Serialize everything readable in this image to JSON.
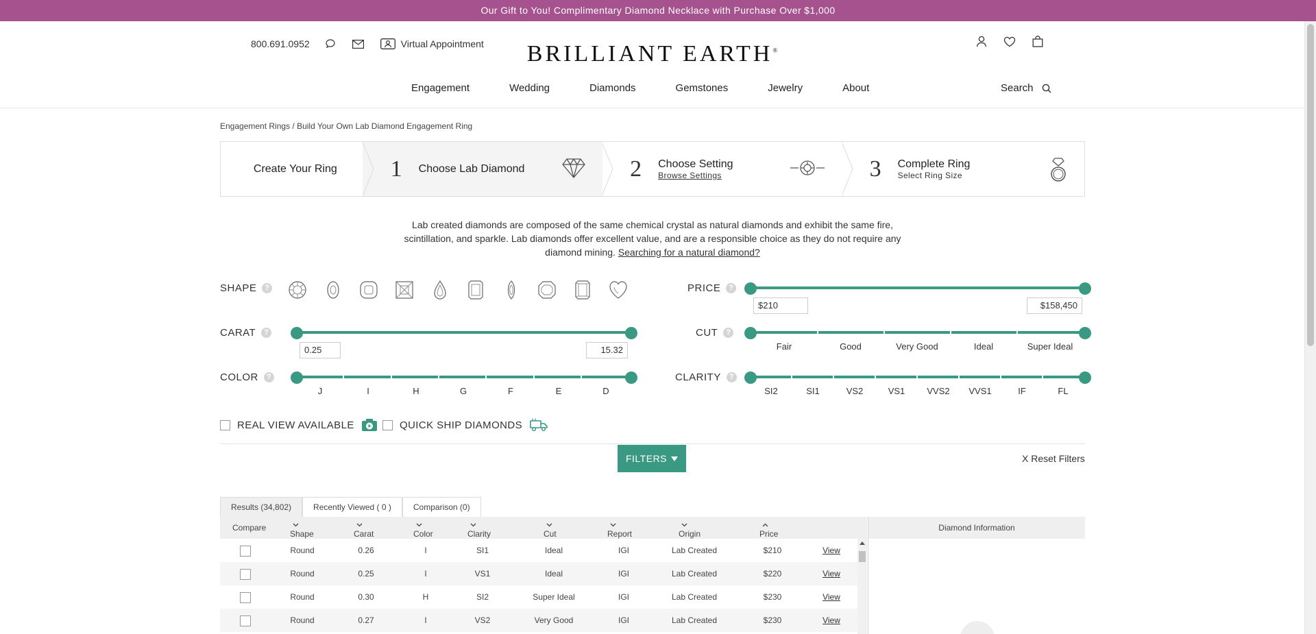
{
  "promo": {
    "text": "Our Gift to You! Complimentary Diamond Necklace with Purchase Over $1,000"
  },
  "header": {
    "phone": "800.691.0952",
    "virtual_appointment": "Virtual Appointment",
    "logo": "BRILLIANT EARTH",
    "logo_mark": "®",
    "nav": [
      "Engagement",
      "Wedding",
      "Diamonds",
      "Gemstones",
      "Jewelry",
      "About"
    ],
    "search_label": "Search"
  },
  "breadcrumb": "Engagement Rings / Build Your Own Lab Diamond Engagement Ring",
  "steps": {
    "create": "Create Your Ring",
    "step1": {
      "num": "1",
      "label": "Choose Lab Diamond"
    },
    "step2": {
      "num": "2",
      "label": "Choose Setting",
      "sub": "Browse Settings"
    },
    "step3": {
      "num": "3",
      "label": "Complete Ring",
      "sub": "Select Ring Size"
    }
  },
  "intro": {
    "text": "Lab created diamonds are composed of the same chemical crystal as natural diamonds and exhibit the same fire, scintillation, and sparkle. Lab diamonds offer excellent value, and are a responsible choice as they do not require any diamond mining.",
    "link": "Searching for a natural diamond?"
  },
  "filters": {
    "shape_label": "SHAPE",
    "shapes": [
      "round",
      "oval",
      "cushion",
      "princess",
      "pear",
      "emerald",
      "marquise",
      "asscher",
      "radiant",
      "heart"
    ],
    "price_label": "PRICE",
    "price_min": "$210",
    "price_max": "$158,450",
    "carat_label": "CARAT",
    "carat_min": "0.25",
    "carat_max": "15.32",
    "cut_label": "CUT",
    "cut_grades": [
      "Fair",
      "Good",
      "Very Good",
      "Ideal",
      "Super Ideal"
    ],
    "color_label": "COLOR",
    "color_grades": [
      "J",
      "I",
      "H",
      "G",
      "F",
      "E",
      "D"
    ],
    "clarity_label": "CLARITY",
    "clarity_grades": [
      "SI2",
      "SI1",
      "VS2",
      "VS1",
      "VVS2",
      "VVS1",
      "IF",
      "FL"
    ],
    "help_glyph": "?",
    "real_view": "REAL VIEW AVAILABLE",
    "quick_ship": "QUICK SHIP DIAMONDS",
    "filters_button": "FILTERS",
    "reset": "X Reset Filters"
  },
  "results": {
    "tabs": [
      "Results (34,802)",
      "Recently Viewed ( 0 )",
      "Comparison (0)"
    ],
    "columns": [
      "Compare",
      "Shape",
      "Carat",
      "Color",
      "Clarity",
      "Cut",
      "Report",
      "Origin",
      "Price"
    ],
    "info_header": "Diamond Information",
    "rows": [
      {
        "shape": "Round",
        "carat": "0.26",
        "color": "I",
        "clarity": "SI1",
        "cut": "Ideal",
        "report": "IGI",
        "origin": "Lab Created",
        "price": "$210",
        "action": "View"
      },
      {
        "shape": "Round",
        "carat": "0.25",
        "color": "I",
        "clarity": "VS1",
        "cut": "Ideal",
        "report": "IGI",
        "origin": "Lab Created",
        "price": "$220",
        "action": "View"
      },
      {
        "shape": "Round",
        "carat": "0.30",
        "color": "H",
        "clarity": "SI2",
        "cut": "Super Ideal",
        "report": "IGI",
        "origin": "Lab Created",
        "price": "$230",
        "action": "View"
      },
      {
        "shape": "Round",
        "carat": "0.27",
        "color": "I",
        "clarity": "VS2",
        "cut": "Very Good",
        "report": "IGI",
        "origin": "Lab Created",
        "price": "$230",
        "action": "View"
      }
    ]
  },
  "colors": {
    "accent": "#3a9983",
    "promo": "#a6528e"
  }
}
